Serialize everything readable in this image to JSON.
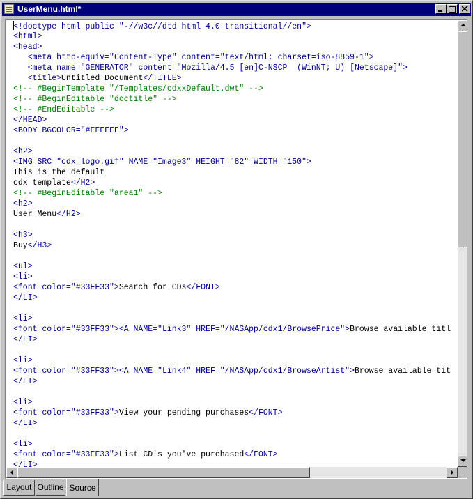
{
  "window": {
    "title": "UserMenu.html*"
  },
  "code_lines": [
    [
      [
        "t",
        "<!doctype html public \"-//w3c//dtd html 4.0 transitional//en\">"
      ]
    ],
    [
      [
        "t",
        "<html>"
      ]
    ],
    [
      [
        "t",
        "<head>"
      ]
    ],
    [
      [
        "",
        "   "
      ],
      [
        "t",
        "<meta http-equiv=\"Content-Type\" content=\"text/html; charset=iso-8859-1\">"
      ]
    ],
    [
      [
        "",
        "   "
      ],
      [
        "t",
        "<meta name=\"GENERATOR\" content=\"Mozilla/4.5 [en]C-NSCP  (WinNT; U) [Netscape]\">"
      ]
    ],
    [
      [
        "",
        "   "
      ],
      [
        "t",
        "<title>"
      ],
      [
        "",
        "Untitled Document"
      ],
      [
        "t",
        "</TITLE>"
      ]
    ],
    [
      [
        "c",
        "<!-- #BeginTemplate \"/Templates/cdxxDefault.dwt\" -->"
      ]
    ],
    [
      [
        "c",
        "<!-- #BeginEditable \"doctitle\" -->"
      ]
    ],
    [
      [
        "c",
        "<!-- #EndEditable -->"
      ]
    ],
    [
      [
        "t",
        "</HEAD>"
      ]
    ],
    [
      [
        "t",
        "<BODY BGCOLOR=\"#FFFFFF\">"
      ]
    ],
    [],
    [
      [
        "t",
        "<h2>"
      ]
    ],
    [
      [
        "t",
        "<IMG SRC=\"cdx_logo.gif\" NAME=\"Image3\" HEIGHT=\"82\" WIDTH=\"150\">"
      ]
    ],
    [
      [
        "",
        "This is the default"
      ]
    ],
    [
      [
        "",
        "cdx template"
      ],
      [
        "t",
        "</H2>"
      ]
    ],
    [
      [
        "c",
        "<!-- #BeginEditable \"area1\" -->"
      ]
    ],
    [
      [
        "t",
        "<h2>"
      ]
    ],
    [
      [
        "",
        "User Menu"
      ],
      [
        "t",
        "</H2>"
      ]
    ],
    [],
    [
      [
        "t",
        "<h3>"
      ]
    ],
    [
      [
        "",
        "Buy"
      ],
      [
        "t",
        "</H3>"
      ]
    ],
    [],
    [
      [
        "t",
        "<ul>"
      ]
    ],
    [
      [
        "t",
        "<li>"
      ]
    ],
    [
      [
        "t",
        "<font color=\"#33FF33\">"
      ],
      [
        "",
        "Search for CDs"
      ],
      [
        "t",
        "</FONT>"
      ]
    ],
    [
      [
        "t",
        "</LI>"
      ]
    ],
    [],
    [
      [
        "t",
        "<li>"
      ]
    ],
    [
      [
        "t",
        "<font color=\"#33FF33\">"
      ],
      [
        "t",
        "<A NAME=\"Link3\" HREF=\"/NASApp/cdx1/BrowsePrice\">"
      ],
      [
        "",
        "Browse available titl"
      ]
    ],
    [
      [
        "t",
        "</LI>"
      ]
    ],
    [],
    [
      [
        "t",
        "<li>"
      ]
    ],
    [
      [
        "t",
        "<font color=\"#33FF33\">"
      ],
      [
        "t",
        "<A NAME=\"Link4\" HREF=\"/NASApp/cdx1/BrowseArtist\">"
      ],
      [
        "",
        "Browse available tit"
      ]
    ],
    [
      [
        "t",
        "</LI>"
      ]
    ],
    [],
    [
      [
        "t",
        "<li>"
      ]
    ],
    [
      [
        "t",
        "<font color=\"#33FF33\">"
      ],
      [
        "",
        "View your pending purchases"
      ],
      [
        "t",
        "</FONT>"
      ]
    ],
    [
      [
        "t",
        "</LI>"
      ]
    ],
    [],
    [
      [
        "t",
        "<li>"
      ]
    ],
    [
      [
        "t",
        "<font color=\"#33FF33\">"
      ],
      [
        "",
        "List CD's you've purchased"
      ],
      [
        "t",
        "</FONT>"
      ]
    ],
    [
      [
        "t",
        "</LI>"
      ]
    ]
  ],
  "tabs": [
    {
      "label": "Layout",
      "active": false
    },
    {
      "label": "Outline",
      "active": false
    },
    {
      "label": "Source",
      "active": true
    }
  ],
  "colors": {
    "tag": "#00008b",
    "comment": "#008000",
    "text": "#000000",
    "titlebar": "#00007b"
  },
  "scroll": {
    "vertical_position": 0.0,
    "horizontal_position": 0.0
  }
}
